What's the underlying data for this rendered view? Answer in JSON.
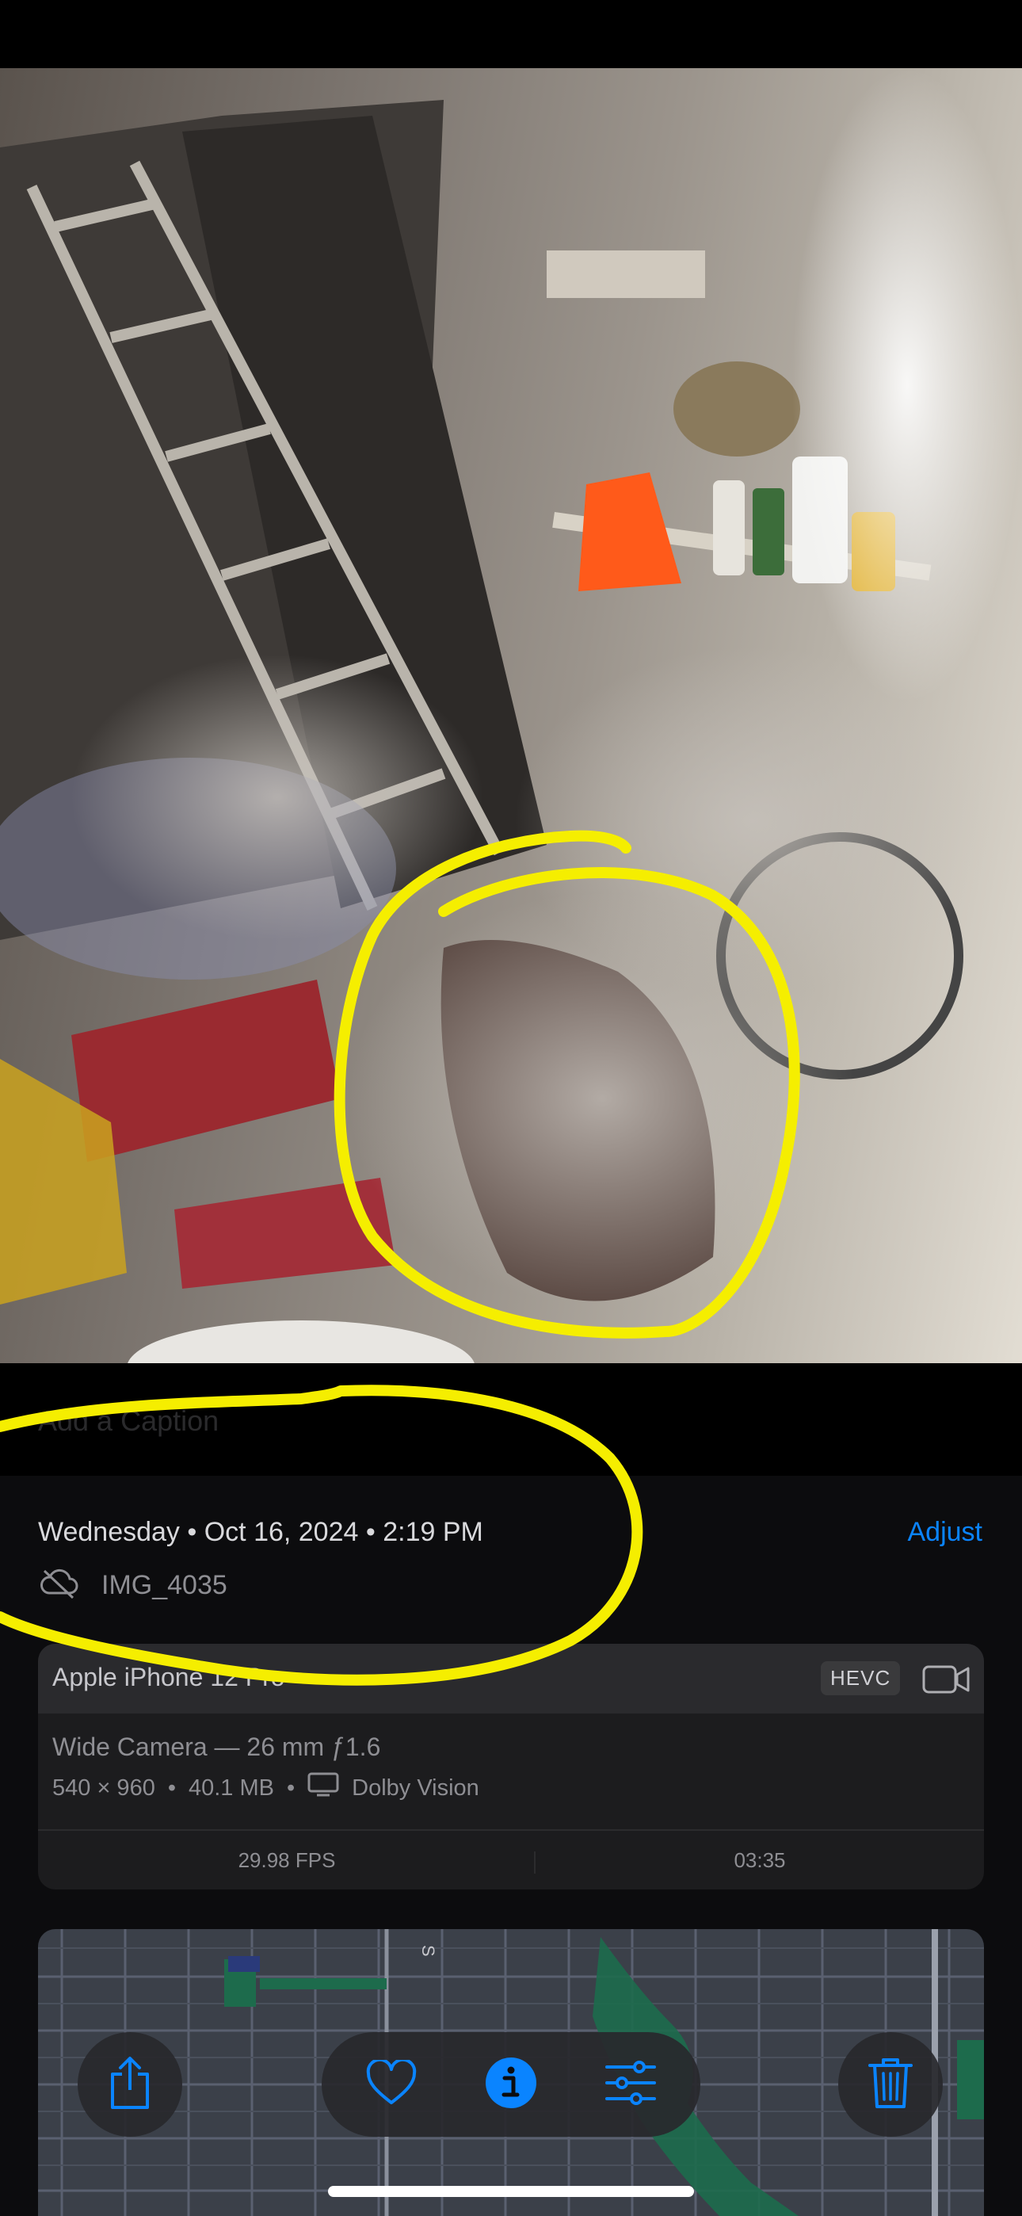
{
  "caption": {
    "placeholder": "Add a Caption"
  },
  "info": {
    "date_line": "Wednesday • Oct 16, 2024 • 2:19 PM",
    "adjust_label": "Adjust",
    "filename": "IMG_4035"
  },
  "camera": {
    "device": "Apple iPhone 12 Pro",
    "format_badge": "HEVC",
    "lens": "Wide Camera — 26 mm ƒ1.6",
    "resolution": "540 × 960",
    "file_size": "40.1 MB",
    "hdr": "Dolby Vision",
    "fps": "29.98 FPS",
    "duration": "03:35"
  },
  "map": {
    "street_label": "S"
  },
  "icons": {
    "cloud": "cloud-slash-icon",
    "video": "video-camera-icon",
    "display": "display-icon",
    "share": "share-icon",
    "favorite": "heart-icon",
    "info": "info-icon",
    "adjustments": "sliders-icon",
    "delete": "trash-icon"
  },
  "colors": {
    "accent": "#0a84ff",
    "annotation": "#f5ee00",
    "panel_bg": "#0c0c0e",
    "card_bg": "#1c1c1e"
  }
}
